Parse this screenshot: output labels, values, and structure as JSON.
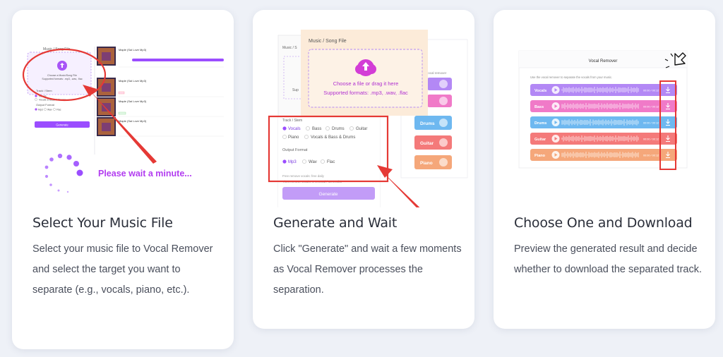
{
  "steps": [
    {
      "title": "Select Your Music File",
      "description": "Select your music file to Vocal Remover and select the target you want to separate (e.g., vocals, piano, etc.).",
      "illustration": {
        "panel_label": "Music / Song File",
        "upload_line1": "Choose a Music/Song File",
        "upload_line2": "Supported formats: .mp3, .wav, .flac",
        "track_label": "Track / Stem",
        "option1": "Vocals",
        "option2": "Vocals & Bass & Drums",
        "output_label": "Output Format",
        "fmt1": "Mp3",
        "fmt2": "Wav",
        "fmt3": "Flac",
        "generate": "Generate",
        "song": "Maple (Sai Love Mp3)",
        "wait": "Please wait a minute..."
      }
    },
    {
      "title": "Generate and Wait",
      "description": "Click \"Generate\" and wait a few moments as Vocal Remover processes the separation.",
      "illustration": {
        "panel_label": "Music / Song File",
        "upload_line1": "Choose a file or drag it here",
        "upload_line2": "Supported formats: .mp3, .wav, .flac",
        "track_label": "Track / Stem",
        "stems": [
          "Vocals",
          "Bass",
          "Drums",
          "Guitar",
          "Piano",
          "Vocals & Bass & Drums"
        ],
        "output_label": "Output Format",
        "formats": [
          "Mp3",
          "Wav",
          "Flac"
        ],
        "credit_line1": "Free remove vocals: free daily",
        "credit_line2": "Then remove vocals: 1 removal / 10 credits",
        "generate": "Generate",
        "side_label": "vocal remover",
        "side_buttons": [
          "Drums",
          "Guitar",
          "Piano"
        ],
        "bg_label1": "Music / S",
        "bg_label2": "Sup"
      }
    },
    {
      "title": "Choose One and Download",
      "description": "Preview the generated result and decide whether to download the separated track.",
      "illustration": {
        "window_title": "Vocal Remover",
        "subtitle": "Use the vocal remover to separate the vocals from your music.",
        "time_text": "00:00 / 00:12",
        "tracks": [
          {
            "label": "Vocals",
            "color": "#b388f5"
          },
          {
            "label": "Bass",
            "color": "#f07ac8"
          },
          {
            "label": "Drums",
            "color": "#6eb8f0"
          },
          {
            "label": "Guitar",
            "color": "#f47a7a"
          },
          {
            "label": "Piano",
            "color": "#f5a77a"
          }
        ]
      }
    }
  ],
  "colors": {
    "accent": "#9b4dff",
    "highlight": "#e53935",
    "background": "#eef1f7"
  }
}
